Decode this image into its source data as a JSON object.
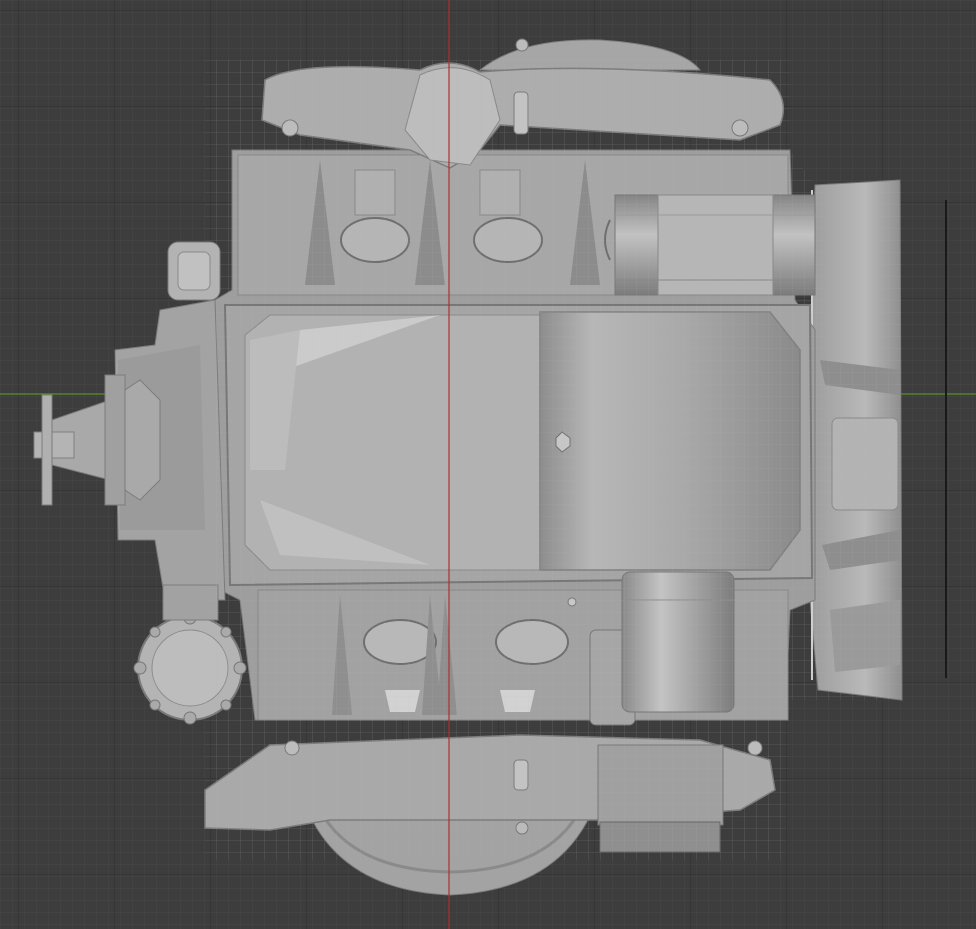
{
  "viewport": {
    "view": "3d-viewport-bottom-orthographic",
    "background_color": "#3d3d3d",
    "grid": true,
    "grid_minor_color": "#474747",
    "grid_major_color": "#2f2f2f",
    "axis_x_color": "#5b8f2a",
    "axis_y_color": "#b03030"
  },
  "model": {
    "name": "engine-block-mesh",
    "base_color": "#a8a8a8",
    "light_color": "#c6c6c6",
    "dark_color": "#7e7e7e",
    "wire_overlay_color": "#b4b4b4"
  }
}
